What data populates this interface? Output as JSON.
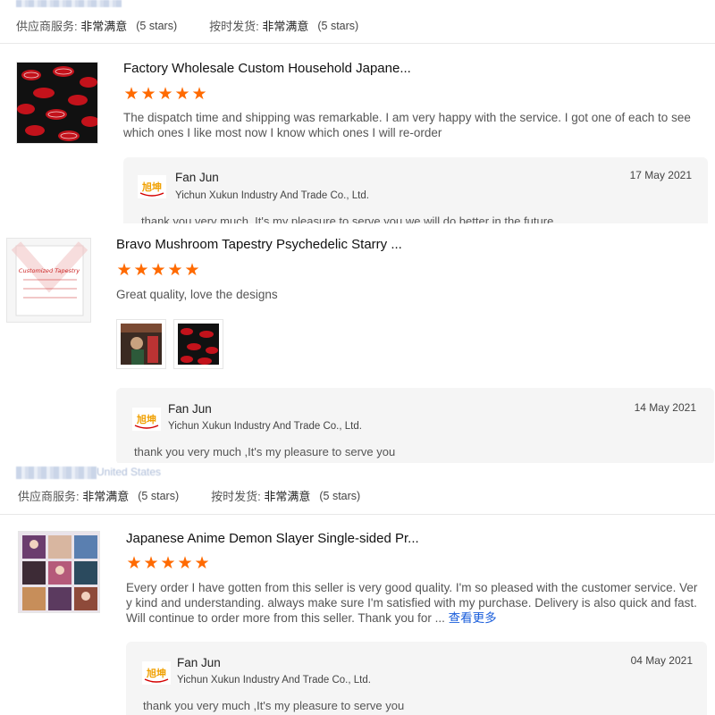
{
  "ratings": {
    "supplier_label": "供应商服务:",
    "supplier_value": "非常满意",
    "supplier_stars": "(5 stars)",
    "ship_label": "按时发货:",
    "ship_value": "非常满意",
    "ship_stars": "(5 stars)"
  },
  "blurred_names": {
    "top": "yusono",
    "mid": "United States"
  },
  "reviews": [
    {
      "title": "Factory Wholesale Custom Household Japane...",
      "stars": 5,
      "comment_line1": "The dispatch time and shipping was remarkable. I am very happy with the service. I got one of each to see",
      "comment_line2": "which ones I like most now I know which ones I will re-order",
      "reply": {
        "name": "Fan Jun",
        "company": "Yichun Xukun Industry And Trade Co., Ltd.",
        "date": "17 May 2021",
        "message": "thank you very much ,It's my pleasure to serve you,we will do better in the future"
      }
    },
    {
      "title": "Bravo Mushroom Tapestry Psychedelic Starry ...",
      "stars": 5,
      "comment_line1": "Great quality, love the designs",
      "thumb_text": "Customized Tapestry",
      "reply": {
        "name": "Fan Jun",
        "company": "Yichun Xukun Industry And Trade Co., Ltd.",
        "date": "14 May 2021",
        "message": "thank you very much ,It's my pleasure to serve you"
      }
    },
    {
      "title": "Japanese Anime Demon Slayer Single-sided Pr...",
      "stars": 5,
      "comment_line1": "Every order I have gotten from this seller is very good quality. I'm so pleased with the customer service. Ver",
      "comment_line2": "y kind and understanding. always make sure I'm satisfied with my purchase. Delivery is also quick and fast.",
      "comment_line3": "Will continue to order more from this seller. Thank you for ...",
      "more_label": "查看更多",
      "reply": {
        "name": "Fan Jun",
        "company": "Yichun Xukun Industry And Trade Co., Ltd.",
        "date": "04 May 2021",
        "message": "thank you very much ,It's my pleasure to serve you"
      }
    }
  ],
  "colors": {
    "star": "#ff6a00",
    "link": "#1a5edb",
    "reply_bg": "#f5f5f5"
  }
}
